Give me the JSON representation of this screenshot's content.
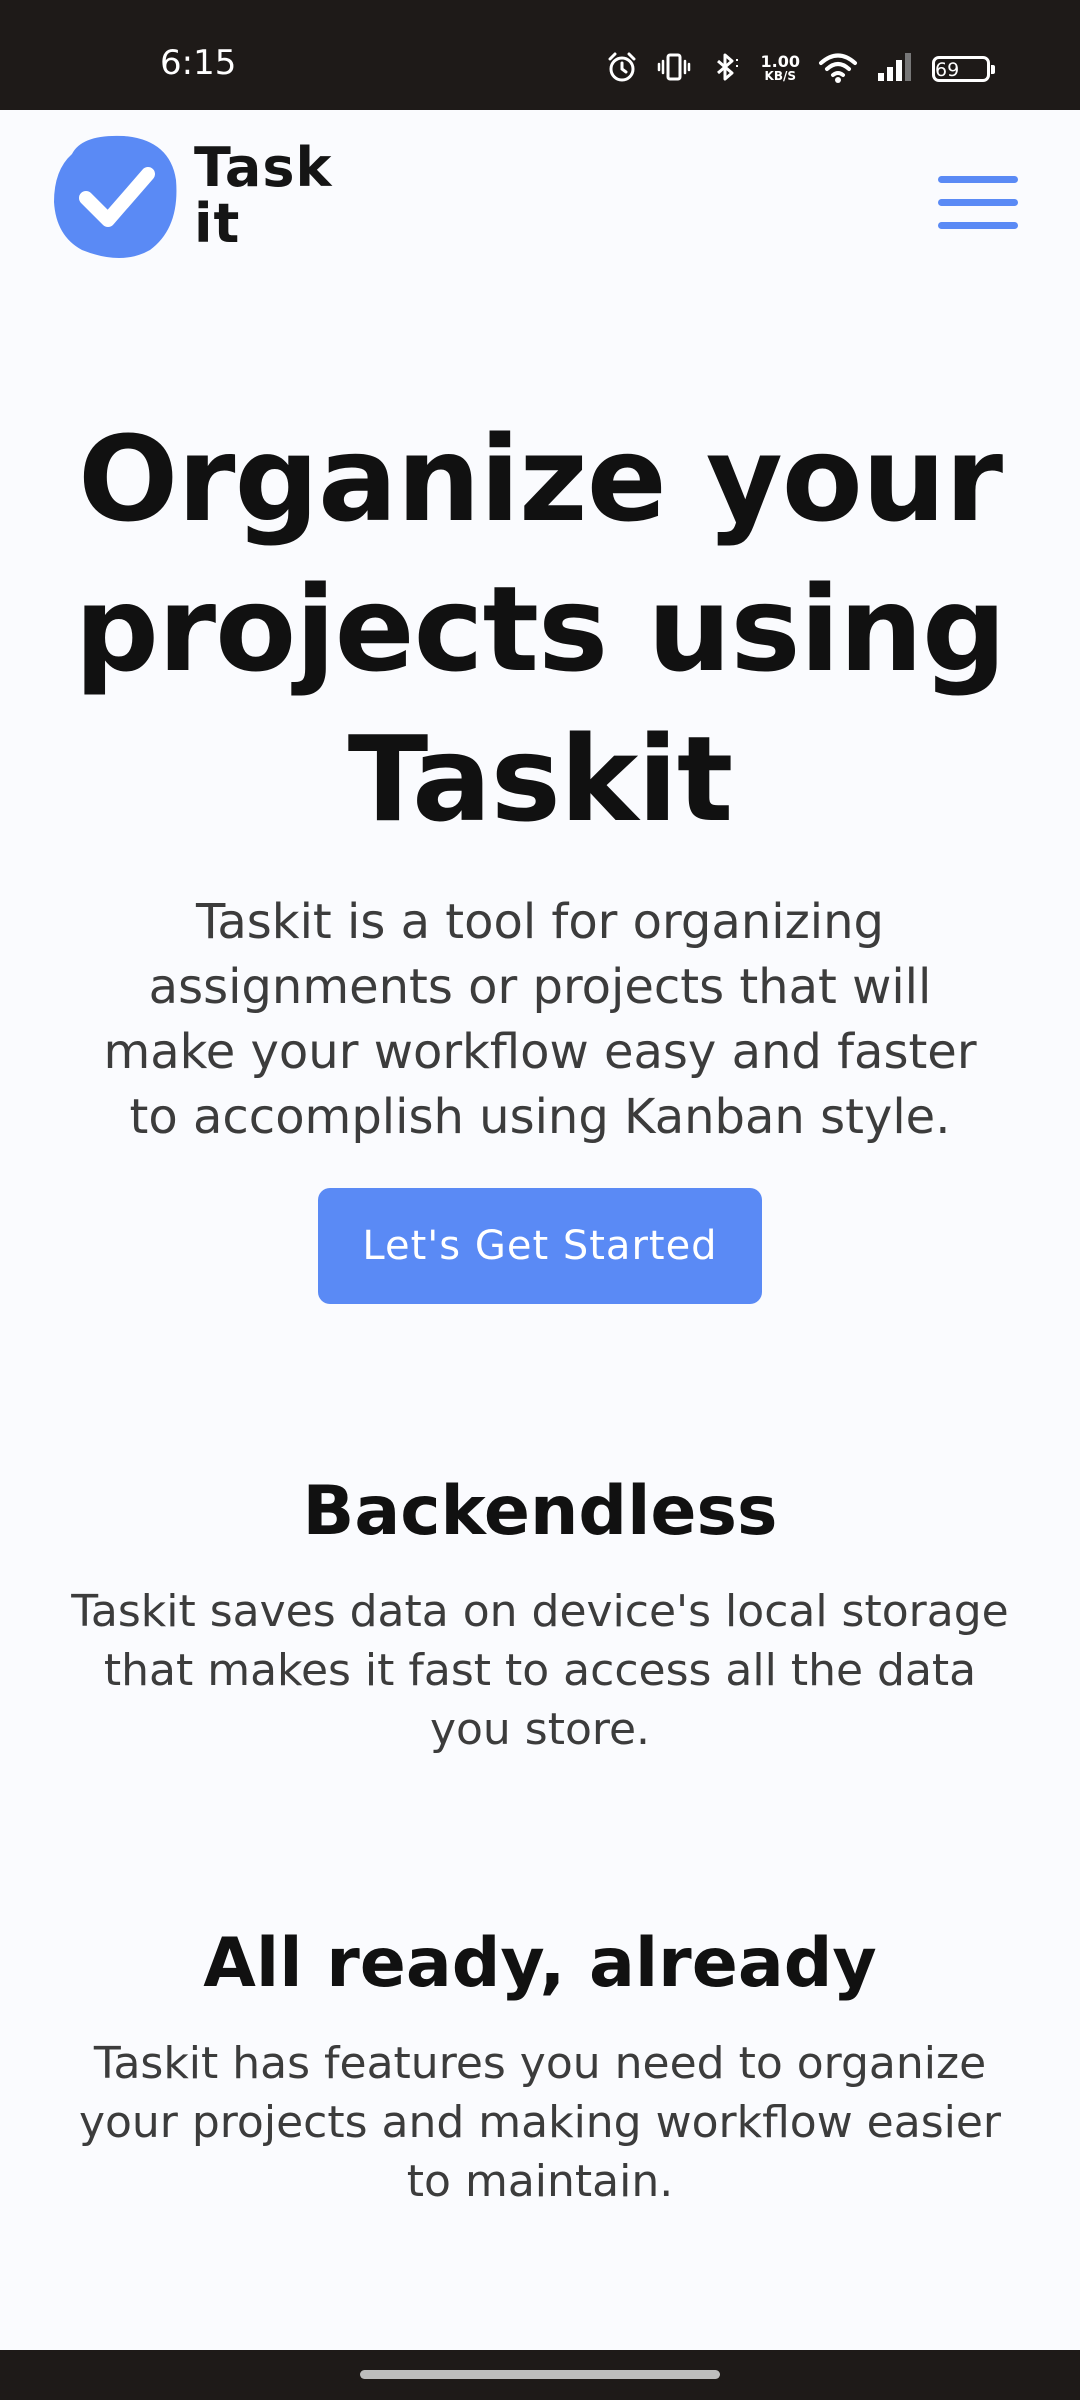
{
  "status_bar": {
    "time": "6:15",
    "net_speed_value": "1.00",
    "net_speed_unit": "KB/S",
    "battery": "69"
  },
  "header": {
    "logo_text_line1": "Task",
    "logo_text_line2": "it",
    "accent_color": "#5a8af5",
    "menu_icon": "hamburger-menu-icon"
  },
  "hero": {
    "title_line1": "Organize your",
    "title_line2": "projects using",
    "title_line3": "Taskit",
    "desc_line1": "Taskit is a tool for organizing",
    "desc_line2": "assignments or projects that will",
    "desc_line3": "make your workflow easy and faster",
    "desc_line4": "to accomplish using Kanban style.",
    "cta_label": "Let's Get Started"
  },
  "features": [
    {
      "title": "Backendless",
      "desc_line1": "Taskit saves data on device's local storage",
      "desc_line2": "that makes it fast to access all the data",
      "desc_line3": "you store."
    },
    {
      "title": "All ready, already",
      "desc_line1": "Taskit has features you need to organize",
      "desc_line2": "your projects and making workflow easier",
      "desc_line3": "to maintain."
    }
  ]
}
